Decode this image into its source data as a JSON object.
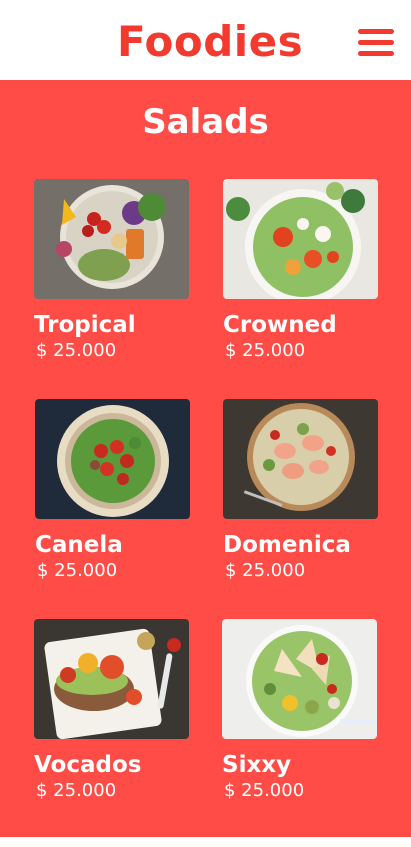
{
  "header": {
    "logo": "Foodies",
    "menu_icon": "hamburger-menu-icon"
  },
  "main": {
    "title": "Salads",
    "items": [
      {
        "name": "Tropical",
        "price": "$ 25.000"
      },
      {
        "name": "Crowned",
        "price": "$ 25.000"
      },
      {
        "name": "Canela",
        "price": "$ 25.000"
      },
      {
        "name": "Domenica",
        "price": "$ 25.000"
      },
      {
        "name": "Vocados",
        "price": "$ 25.000"
      },
      {
        "name": "Sixxy",
        "price": "$ 25.000"
      }
    ]
  },
  "colors": {
    "brand": "#f23a2e",
    "background": "#ff4c46"
  }
}
